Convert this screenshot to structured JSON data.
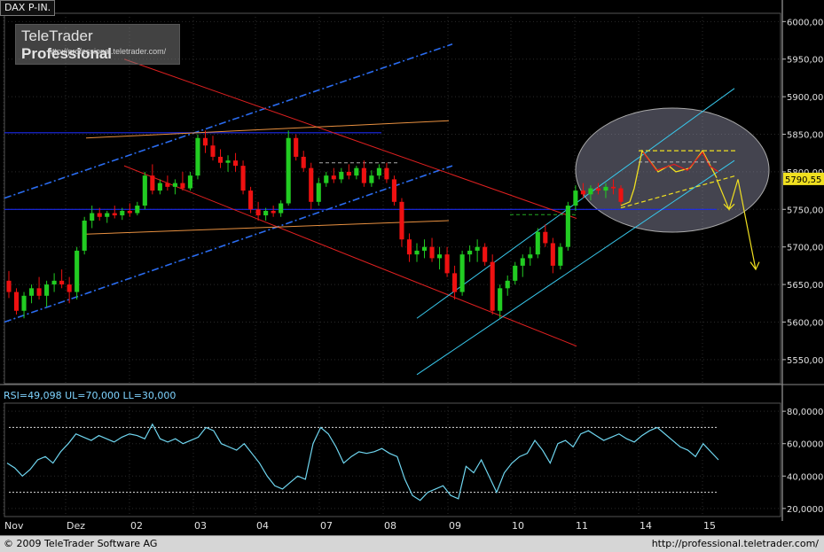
{
  "title": "DAX P-IN.",
  "logo": {
    "brand": "TeleTrader",
    "product": "Professional",
    "url": "http://professional.teletrader.com/"
  },
  "footer": {
    "copyright": "© 2009 TeleTrader Software AG",
    "url": "http://professional.teletrader.com/"
  },
  "rsi_label": "RSI=49,098 UL=70,000 LL=30,000",
  "last_price_label": "5790,55",
  "colors": {
    "up_candle": "#22cc22",
    "down_candle": "#ee1111",
    "rsi_line": "#6fd6f0",
    "channel_blue": "#2a6cf0",
    "channel_cyan": "#38c8ec",
    "trend_red": "#e02020",
    "trend_orange": "#e89040",
    "pattern_yellow": "#f0e020",
    "horizontal_blue": "#1a2aee",
    "last_price_bg": "#f0e020"
  },
  "chart_data": [
    {
      "type": "candlestick",
      "title": "DAX P-IN.",
      "x_tick_labels": [
        "Nov",
        "Dez",
        "02",
        "03",
        "04",
        "07",
        "08",
        "09",
        "10",
        "11",
        "14",
        "15"
      ],
      "y_tick_labels": [
        "5550,00",
        "5600,00",
        "5650,00",
        "5700,00",
        "5750,00",
        "5800,00",
        "5850,00",
        "5900,00",
        "5950,00",
        "6000,00"
      ],
      "ylim": [
        5518,
        6011
      ],
      "last_price": 5790.55,
      "grid": true,
      "ohlc": [
        [
          5655,
          5668,
          5632,
          5640
        ],
        [
          5640,
          5645,
          5610,
          5615
        ],
        [
          5615,
          5640,
          5605,
          5635
        ],
        [
          5635,
          5650,
          5625,
          5645
        ],
        [
          5645,
          5660,
          5630,
          5635
        ],
        [
          5635,
          5655,
          5620,
          5650
        ],
        [
          5650,
          5665,
          5640,
          5655
        ],
        [
          5655,
          5670,
          5645,
          5650
        ],
        [
          5650,
          5660,
          5625,
          5640
        ],
        [
          5640,
          5700,
          5630,
          5695
        ],
        [
          5695,
          5740,
          5690,
          5735
        ],
        [
          5735,
          5755,
          5725,
          5745
        ],
        [
          5745,
          5752,
          5735,
          5740
        ],
        [
          5740,
          5748,
          5732,
          5745
        ],
        [
          5745,
          5755,
          5738,
          5742
        ],
        [
          5742,
          5752,
          5736,
          5748
        ],
        [
          5748,
          5758,
          5740,
          5745
        ],
        [
          5745,
          5760,
          5742,
          5755
        ],
        [
          5755,
          5800,
          5750,
          5795
        ],
        [
          5795,
          5810,
          5770,
          5775
        ],
        [
          5775,
          5790,
          5770,
          5785
        ],
        [
          5785,
          5795,
          5775,
          5780
        ],
        [
          5780,
          5790,
          5770,
          5785
        ],
        [
          5785,
          5800,
          5775,
          5778
        ],
        [
          5778,
          5800,
          5775,
          5795
        ],
        [
          5795,
          5850,
          5790,
          5845
        ],
        [
          5845,
          5855,
          5825,
          5835
        ],
        [
          5835,
          5848,
          5815,
          5820
        ],
        [
          5820,
          5830,
          5805,
          5812
        ],
        [
          5812,
          5822,
          5800,
          5815
        ],
        [
          5815,
          5825,
          5800,
          5808
        ],
        [
          5808,
          5815,
          5770,
          5775
        ],
        [
          5775,
          5780,
          5745,
          5750
        ],
        [
          5750,
          5760,
          5735,
          5742
        ],
        [
          5742,
          5752,
          5735,
          5748
        ],
        [
          5748,
          5755,
          5740,
          5745
        ],
        [
          5745,
          5762,
          5740,
          5758
        ],
        [
          5758,
          5855,
          5755,
          5845
        ],
        [
          5845,
          5850,
          5815,
          5820
        ],
        [
          5820,
          5828,
          5800,
          5805
        ],
        [
          5805,
          5812,
          5750,
          5760
        ],
        [
          5760,
          5792,
          5755,
          5785
        ],
        [
          5785,
          5800,
          5780,
          5795
        ],
        [
          5795,
          5805,
          5785,
          5790
        ],
        [
          5790,
          5805,
          5785,
          5800
        ],
        [
          5800,
          5810,
          5790,
          5795
        ],
        [
          5795,
          5808,
          5790,
          5805
        ],
        [
          5805,
          5815,
          5780,
          5785
        ],
        [
          5785,
          5802,
          5780,
          5795
        ],
        [
          5795,
          5810,
          5790,
          5805
        ],
        [
          5805,
          5812,
          5785,
          5790
        ],
        [
          5790,
          5795,
          5755,
          5760
        ],
        [
          5760,
          5765,
          5700,
          5710
        ],
        [
          5710,
          5718,
          5680,
          5690
        ],
        [
          5690,
          5705,
          5680,
          5695
        ],
        [
          5695,
          5710,
          5685,
          5700
        ],
        [
          5700,
          5712,
          5680,
          5685
        ],
        [
          5685,
          5700,
          5670,
          5690
        ],
        [
          5690,
          5700,
          5660,
          5665
        ],
        [
          5665,
          5675,
          5630,
          5640
        ],
        [
          5640,
          5695,
          5635,
          5690
        ],
        [
          5690,
          5702,
          5680,
          5695
        ],
        [
          5695,
          5710,
          5680,
          5700
        ],
        [
          5700,
          5705,
          5675,
          5680
        ],
        [
          5680,
          5690,
          5610,
          5615
        ],
        [
          5615,
          5650,
          5605,
          5645
        ],
        [
          5645,
          5662,
          5635,
          5655
        ],
        [
          5655,
          5680,
          5650,
          5675
        ],
        [
          5675,
          5690,
          5660,
          5685
        ],
        [
          5685,
          5700,
          5675,
          5690
        ],
        [
          5690,
          5725,
          5685,
          5720
        ],
        [
          5720,
          5730,
          5700,
          5705
        ],
        [
          5705,
          5712,
          5665,
          5675
        ],
        [
          5675,
          5705,
          5670,
          5700
        ],
        [
          5700,
          5760,
          5695,
          5755
        ],
        [
          5755,
          5782,
          5748,
          5775
        ],
        [
          5775,
          5785,
          5765,
          5770
        ],
        [
          5770,
          5782,
          5762,
          5778
        ],
        [
          5778,
          5785,
          5770,
          5775
        ],
        [
          5775,
          5785,
          5765,
          5780
        ],
        [
          5780,
          5790,
          5770,
          5778
        ],
        [
          5778,
          5782,
          5755,
          5760
        ]
      ],
      "annotations": [
        "ascending channel",
        "descending channel",
        "ascending channel",
        "ellipse highlight",
        "yellow forecast arrows"
      ]
    },
    {
      "type": "line",
      "title": "RSI=49,098 UL=70,000 LL=30,000",
      "y_tick_labels": [
        "20,0000",
        "40,0000",
        "60,0000",
        "80,0000"
      ],
      "ylim": [
        15,
        85
      ],
      "upper_level": 70,
      "lower_level": 30,
      "series": [
        {
          "name": "RSI",
          "values": [
            48,
            45,
            40,
            44,
            50,
            52,
            48,
            55,
            60,
            66,
            64,
            62,
            65,
            63,
            61,
            64,
            66,
            65,
            63,
            72,
            63,
            61,
            63,
            60,
            62,
            64,
            70,
            68,
            60,
            58,
            56,
            60,
            54,
            48,
            40,
            34,
            32,
            36,
            40,
            38,
            60,
            70,
            66,
            58,
            48,
            52,
            55,
            54,
            55,
            57,
            54,
            52,
            38,
            28,
            25,
            30,
            32,
            34,
            28,
            26,
            46,
            42,
            50,
            40,
            30,
            42,
            48,
            52,
            54,
            62,
            56,
            48,
            60,
            62,
            58,
            66,
            68,
            65,
            62,
            64,
            66,
            63,
            61,
            65,
            68,
            70,
            66,
            62,
            58,
            56,
            52,
            60,
            55,
            50
          ]
        }
      ]
    }
  ]
}
